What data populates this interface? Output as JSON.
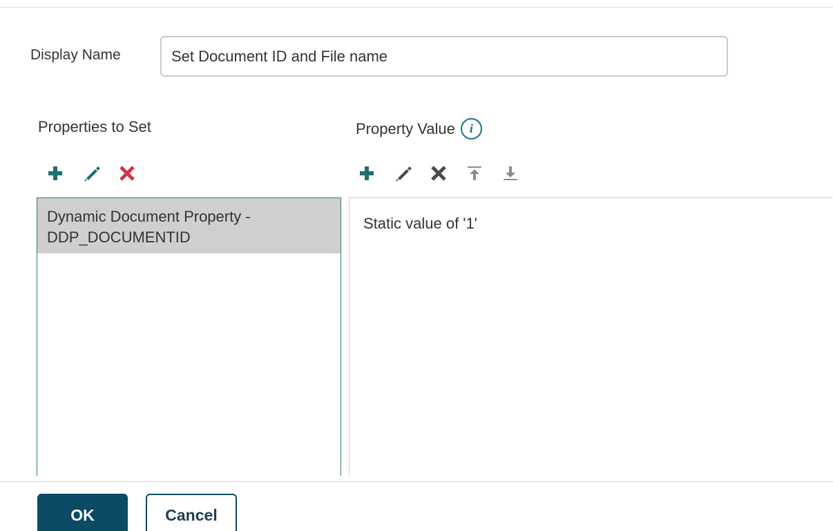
{
  "form": {
    "display_name_label": "Display Name",
    "display_name_value": "Set Document ID and File name"
  },
  "properties": {
    "label": "Properties to Set",
    "items": [
      {
        "label": "Dynamic Document Property - DDP_DOCUMENTID",
        "selected": true
      }
    ]
  },
  "values": {
    "label": "Property Value",
    "items": [
      {
        "label": "Static value of '1'"
      }
    ]
  },
  "icons": {
    "add": "plus-icon",
    "edit": "pencil-icon",
    "delete": "x-icon",
    "move_top": "move-to-top-icon",
    "move_bottom": "move-to-bottom-icon",
    "info": "info-icon"
  },
  "colors": {
    "teal": "#1f6f70",
    "delete_red": "#d0344b",
    "dark_gray": "#4a4a4a",
    "light_gray": "#8c8c8c",
    "primary": "#0c4a66",
    "selected_row": "#cfcfcf"
  },
  "buttons": {
    "ok": "OK",
    "cancel": "Cancel"
  }
}
